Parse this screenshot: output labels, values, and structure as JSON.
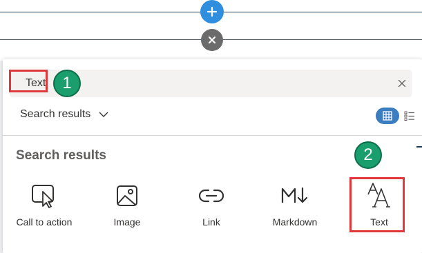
{
  "canvas": {
    "add_section_icon": "plus-icon",
    "close_icon": "close-icon"
  },
  "toolbox": {
    "search": {
      "value": "Text",
      "clear_icon": "dismiss-icon"
    },
    "category_dropdown": {
      "selected": "Search results",
      "icon": "chevron-down-icon"
    },
    "view_toggle": {
      "grid_icon": "grid-view-icon",
      "list_icon": "list-view-icon",
      "active": "grid"
    },
    "results_heading": "Search results",
    "results": [
      {
        "label": "Call to action",
        "icon": "call-to-action-icon"
      },
      {
        "label": "Image",
        "icon": "image-icon"
      },
      {
        "label": "Link",
        "icon": "link-icon"
      },
      {
        "label": "Markdown",
        "icon": "markdown-icon"
      },
      {
        "label": "Text",
        "icon": "text-icon"
      }
    ]
  },
  "annotations": {
    "step1": "1",
    "step2": "2",
    "color": "#1a9e6e",
    "highlight_color": "#e0373a"
  },
  "colors": {
    "accent": "#2f8ede",
    "toggle_active": "#3a7dc0"
  }
}
